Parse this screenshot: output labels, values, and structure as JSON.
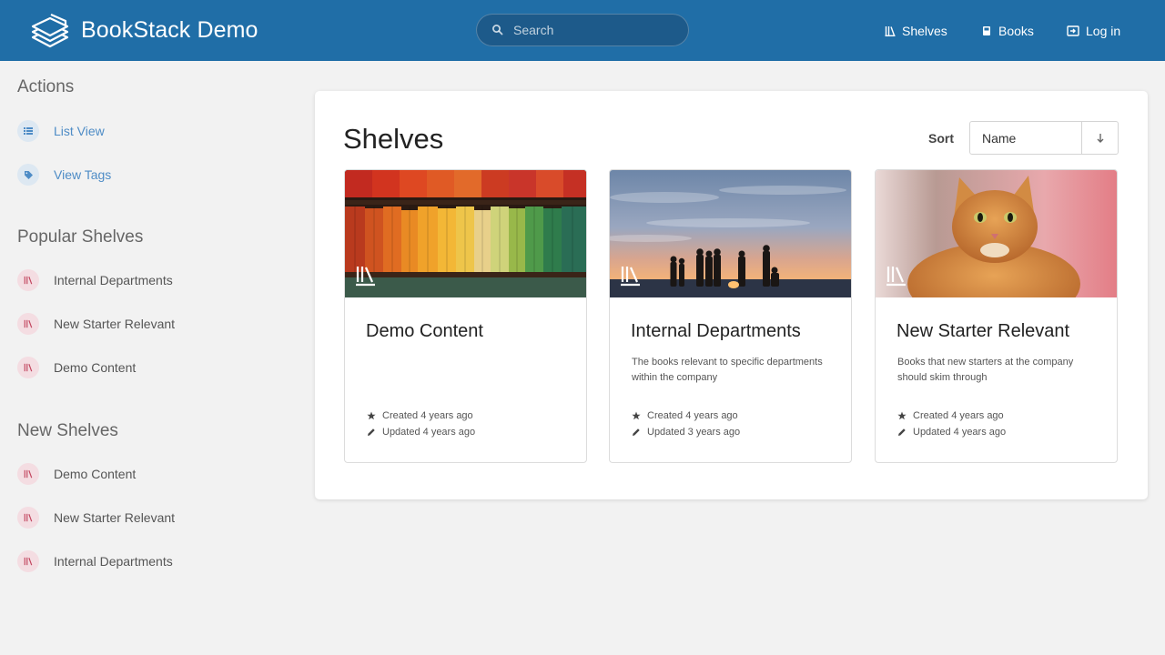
{
  "header": {
    "app_title": "BookStack Demo",
    "search_placeholder": "Search",
    "nav": [
      {
        "label": "Shelves",
        "icon": "shelves-icon"
      },
      {
        "label": "Books",
        "icon": "book-icon"
      },
      {
        "label": "Log in",
        "icon": "login-icon"
      }
    ]
  },
  "sidebar": {
    "actions": {
      "heading": "Actions",
      "items": [
        {
          "label": "List View",
          "icon": "list-icon"
        },
        {
          "label": "View Tags",
          "icon": "tag-icon"
        }
      ]
    },
    "popular": {
      "heading": "Popular Shelves",
      "items": [
        {
          "label": "Internal Departments",
          "icon": "bookshelf-icon"
        },
        {
          "label": "New Starter Relevant",
          "icon": "bookshelf-icon"
        },
        {
          "label": "Demo Content",
          "icon": "bookshelf-icon"
        }
      ]
    },
    "new": {
      "heading": "New Shelves",
      "items": [
        {
          "label": "Demo Content",
          "icon": "bookshelf-icon"
        },
        {
          "label": "New Starter Relevant",
          "icon": "bookshelf-icon"
        },
        {
          "label": "Internal Departments",
          "icon": "bookshelf-icon"
        }
      ]
    }
  },
  "main": {
    "title": "Shelves",
    "sort_label": "Sort",
    "sort_value": "Name",
    "shelves": [
      {
        "name": "Demo Content",
        "description": "",
        "created": "Created 4 years ago",
        "updated": "Updated 4 years ago",
        "cover": "colorful bookshelf"
      },
      {
        "name": "Internal Departments",
        "description": "The books relevant to specific departments within the company",
        "created": "Created 4 years ago",
        "updated": "Updated 3 years ago",
        "cover": "people silhouettes at sunset beach"
      },
      {
        "name": "New Starter Relevant",
        "description": "Books that new starters at the company should skim through",
        "created": "Created 4 years ago",
        "updated": "Updated 4 years ago",
        "cover": "orange cat"
      }
    ]
  },
  "colors": {
    "header": "#206ea7",
    "link": "#4e8cc6",
    "shelf_accent": "#c2455e",
    "background": "#f2f2f2"
  }
}
